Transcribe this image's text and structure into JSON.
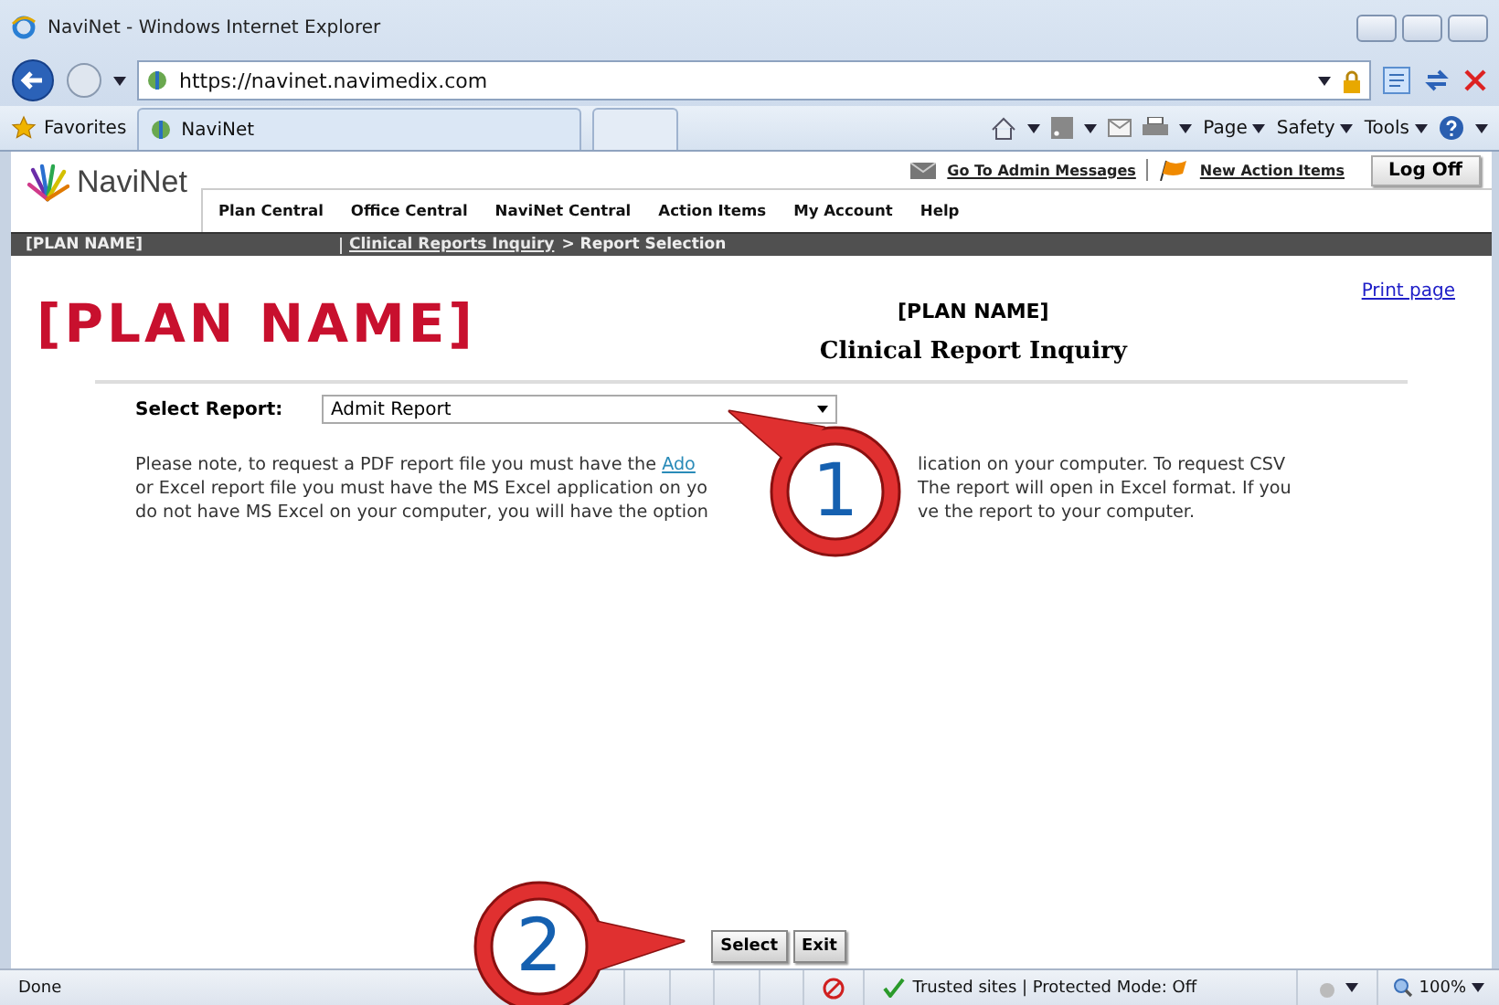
{
  "browser": {
    "title": "NaviNet - Windows Internet Explorer",
    "address": "https://navinet.navimedix.com",
    "favorites": "Favorites",
    "tab": "NaviNet",
    "commands": [
      "Page",
      "Safety",
      "Tools"
    ]
  },
  "header": {
    "logo": "NaviNet",
    "top_links": [
      "Go To Admin Messages",
      "New Action Items"
    ],
    "log_off": "Log Off",
    "nav": [
      "Plan Central",
      "Office Central",
      "NaviNet Central",
      "Action Items",
      "My Account",
      "Help"
    ],
    "plan": "[PLAN NAME]",
    "breadcrumb_link": "Clinical Reports Inquiry",
    "breadcrumb_current": "> Report Selection"
  },
  "content": {
    "brand": "[PLAN NAME]",
    "heading": "[PLAN NAME]",
    "subheading": "Clinical Report Inquiry",
    "print": "Print page",
    "select_label": "Select Report:",
    "select_value": "Admit Report",
    "note_lines": [
      {
        "left": "Please note, to request a PDF report file you must have the ",
        "link": "Ado",
        "right": "lication on your computer. To request CSV"
      },
      {
        "left": "or Excel report file you must have the MS Excel application on yo",
        "right": "The report will open in Excel format. If you"
      },
      {
        "left": "do not have MS Excel on your computer, you will have the option",
        "right": "ve the report to your computer."
      }
    ],
    "buttons": [
      "Select",
      "Exit"
    ]
  },
  "callouts": [
    "1",
    "2"
  ],
  "status_bar": {
    "text": "Done",
    "zone": "Trusted sites | Protected Mode: Off",
    "zoom": "100%"
  }
}
